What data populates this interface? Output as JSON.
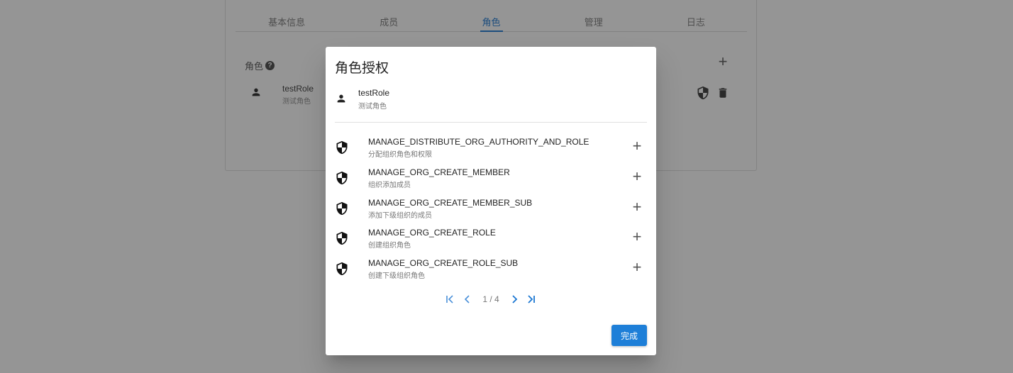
{
  "tabs": [
    {
      "label": "基本信息"
    },
    {
      "label": "成员"
    },
    {
      "label": "角色"
    },
    {
      "label": "管理"
    },
    {
      "label": "日志"
    }
  ],
  "active_tab": "角色",
  "roles_section": {
    "label": "角色",
    "help_glyph": "?",
    "add_glyph": "+",
    "role": {
      "name": "testRole",
      "description": "测试角色"
    }
  },
  "dialog": {
    "title": "角色授权",
    "role": {
      "name": "testRole",
      "description": "测试角色"
    },
    "permissions": [
      {
        "name": "MANAGE_DISTRIBUTE_ORG_AUTHORITY_AND_ROLE",
        "description": "分配组织角色和权限"
      },
      {
        "name": "MANAGE_ORG_CREATE_MEMBER",
        "description": "组织添加成员"
      },
      {
        "name": "MANAGE_ORG_CREATE_MEMBER_SUB",
        "description": "添加下级组织的成员"
      },
      {
        "name": "MANAGE_ORG_CREATE_ROLE",
        "description": "创建组织角色"
      },
      {
        "name": "MANAGE_ORG_CREATE_ROLE_SUB",
        "description": "创建下级组织角色"
      }
    ],
    "add_glyph": "+",
    "pager": {
      "text": "1 / 4",
      "current": 1,
      "total": 4
    },
    "done_label": "完成"
  },
  "colors": {
    "accent": "#1976d2",
    "button": "#1e7fd8",
    "overlay": "rgba(33,33,33,0.48)"
  },
  "icons": [
    "person-icon",
    "shield-icon",
    "trash-icon",
    "plus-icon",
    "first-page-icon",
    "prev-page-icon",
    "next-page-icon",
    "last-page-icon"
  ]
}
